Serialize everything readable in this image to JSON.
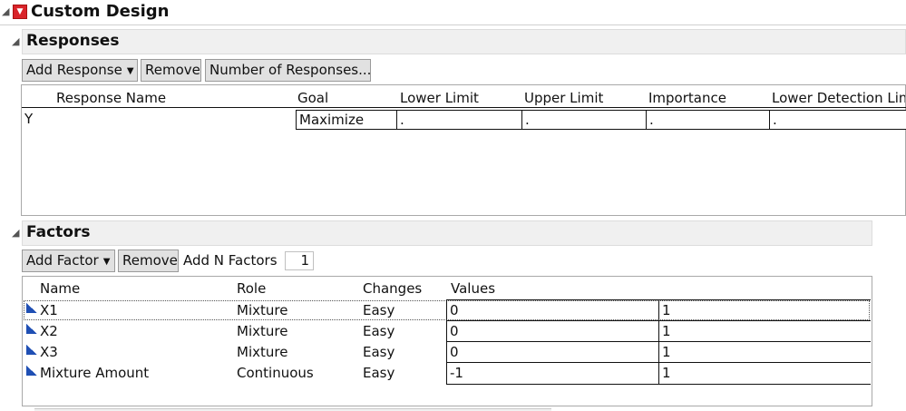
{
  "title": "Custom Design",
  "colors": {
    "red_button": "#d9242a",
    "icon_blue": "#1f4fb4"
  },
  "responses": {
    "header": "Responses",
    "add_label": "Add Response",
    "remove_label": "Remove",
    "number_label": "Number of Responses...",
    "columns": [
      "Response Name",
      "Goal",
      "Lower Limit",
      "Upper Limit",
      "Importance",
      "Lower Detection Lim"
    ],
    "row": {
      "name": "Y",
      "goal": "Maximize",
      "lower": ".",
      "upper": ".",
      "importance": ".",
      "detection": "."
    }
  },
  "factors": {
    "header": "Factors",
    "add_label": "Add Factor",
    "remove_label": "Remove",
    "addn_label": "Add N Factors",
    "addn_value": "1",
    "columns": [
      "Name",
      "Role",
      "Changes",
      "Values"
    ],
    "rows": [
      {
        "name": "X1",
        "role": "Mixture",
        "changes": "Easy",
        "low": "0",
        "high": "1"
      },
      {
        "name": "X2",
        "role": "Mixture",
        "changes": "Easy",
        "low": "0",
        "high": "1"
      },
      {
        "name": "X3",
        "role": "Mixture",
        "changes": "Easy",
        "low": "0",
        "high": "1"
      },
      {
        "name": "Mixture Amount",
        "role": "Continuous",
        "changes": "Easy",
        "low": "-1",
        "high": "1"
      }
    ]
  }
}
